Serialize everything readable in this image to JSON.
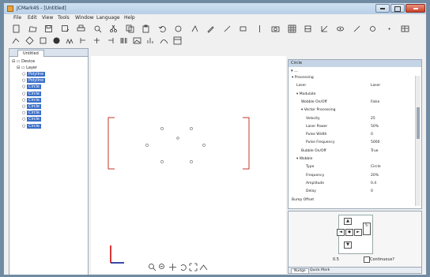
{
  "window": {
    "title": "JCMark4S - [Untitled]"
  },
  "menu": [
    "File",
    "Edit",
    "View",
    "Tools",
    "Window",
    "Language",
    "Help"
  ],
  "toolbar_row1": [
    "new-icon",
    "open-icon",
    "save-icon",
    "saveas-icon",
    "print-icon",
    "preview-icon",
    "cut-icon",
    "copy-icon",
    "paste-icon",
    "undo-icon",
    "redo-icon",
    "text-icon",
    "edit-icon",
    "line-icon",
    "rect-icon",
    "shape-icon",
    "camera-icon",
    "grid-icon",
    "align-icon",
    "transform-icon",
    "eye-icon",
    "pen-icon",
    "circle-icon",
    "dot-icon",
    "table-icon"
  ],
  "toolbar_row2": [
    "polyline-icon",
    "rotate-icon",
    "square-icon",
    "ellipse-icon",
    "hatch-icon",
    "align-left-icon",
    "align-center-icon",
    "align-right-icon",
    "barcode-icon",
    "image-icon",
    "chart-icon",
    "curve-icon",
    "layout-icon"
  ],
  "doc_tab": "Untitled",
  "tree": {
    "root": "Device",
    "group": "Layer",
    "items": [
      "Polyline",
      "Polyline",
      "Circle",
      "Circle",
      "Circle",
      "Circle",
      "Circle",
      "Circle",
      "Circle"
    ]
  },
  "props": {
    "header": "Circle",
    "sub": "▾ ...",
    "rows": [
      {
        "label": "Processing",
        "value": "",
        "level": 0,
        "expander": "▾"
      },
      {
        "label": "Laser",
        "value": "Laser",
        "level": 1,
        "expander": ""
      },
      {
        "label": "Modulate",
        "value": "",
        "level": 1,
        "expander": "▾"
      },
      {
        "label": "Wobble On/Off",
        "value": "False",
        "level": 2,
        "expander": ""
      },
      {
        "label": "Vector Processing",
        "value": "",
        "level": 2,
        "expander": "▾"
      },
      {
        "label": "Velocity",
        "value": "25",
        "level": 3,
        "expander": ""
      },
      {
        "label": "Laser Power",
        "value": "50%",
        "level": 3,
        "expander": ""
      },
      {
        "label": "Pulse Width",
        "value": "0",
        "level": 3,
        "expander": ""
      },
      {
        "label": "Pulse Frequency",
        "value": "5000",
        "level": 3,
        "expander": ""
      },
      {
        "label": "Bubble On/Off",
        "value": "True",
        "level": 2,
        "expander": ""
      },
      {
        "label": "Wobble",
        "value": "",
        "level": 1,
        "expander": "▾"
      },
      {
        "label": "Type",
        "value": "Circle",
        "level": 3,
        "expander": ""
      },
      {
        "label": "Frequency",
        "value": "20%",
        "level": 3,
        "expander": ""
      },
      {
        "label": "Amplitude",
        "value": "0.4",
        "level": 3,
        "expander": ""
      },
      {
        "label": "Delay",
        "value": "0",
        "level": 3,
        "expander": ""
      },
      {
        "label": "Bump Offset",
        "value": "",
        "level": 0,
        "expander": ""
      }
    ]
  },
  "nav": {
    "up": "▲",
    "down": "▼",
    "left": "◄",
    "right": "►",
    "center": "◆",
    "step_value": "0.5",
    "continuous_label": "Continuous?"
  },
  "bottom_tabs": [
    "Nudge",
    "Quick Mark"
  ],
  "view_tools": [
    "zoom-icon",
    "zoom-out-icon",
    "pan-icon",
    "rotate-view-icon",
    "fit-icon",
    "arc-icon"
  ]
}
